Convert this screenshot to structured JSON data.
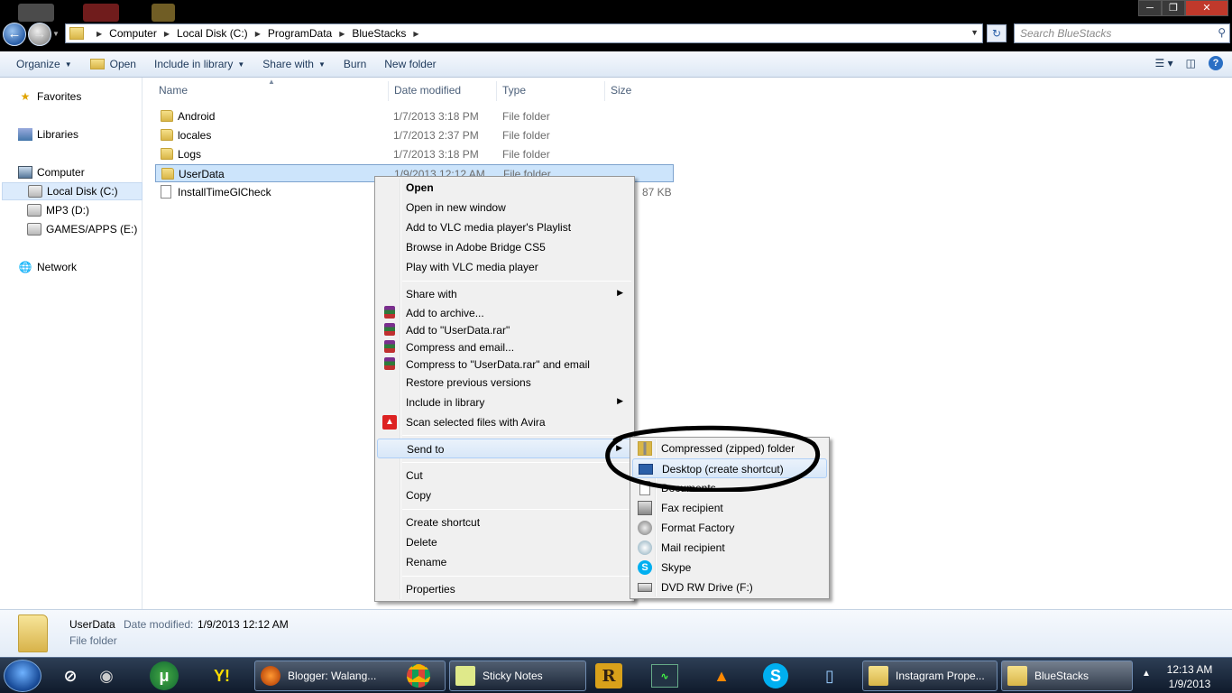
{
  "window": {
    "breadcrumb": [
      "Computer",
      "Local Disk (C:)",
      "ProgramData",
      "BlueStacks"
    ],
    "search_placeholder": "Search BlueStacks"
  },
  "toolbar": {
    "organize": "Organize",
    "open": "Open",
    "include_in_library": "Include in library",
    "share_with": "Share with",
    "burn": "Burn",
    "new_folder": "New folder"
  },
  "nav": {
    "favorites": "Favorites",
    "libraries": "Libraries",
    "computer": "Computer",
    "local_disk": "Local Disk (C:)",
    "mp3": "MP3 (D:)",
    "games": "GAMES/APPS (E:)",
    "network": "Network"
  },
  "columns": {
    "name": "Name",
    "date_modified": "Date modified",
    "type": "Type",
    "size": "Size"
  },
  "files": [
    {
      "name": "Android",
      "date": "1/7/2013 3:18 PM",
      "type": "File folder",
      "size": ""
    },
    {
      "name": "locales",
      "date": "1/7/2013 2:37 PM",
      "type": "File folder",
      "size": ""
    },
    {
      "name": "Logs",
      "date": "1/7/2013 3:18 PM",
      "type": "File folder",
      "size": ""
    },
    {
      "name": "UserData",
      "date": "1/9/2013 12:12 AM",
      "type": "File folder",
      "size": ""
    },
    {
      "name": "InstallTimeGlCheck",
      "date": "",
      "type": "",
      "size": "87 KB"
    }
  ],
  "context_menu": {
    "open": "Open",
    "open_new_window": "Open in new window",
    "add_vlc_playlist": "Add to VLC media player's Playlist",
    "browse_bridge": "Browse in Adobe Bridge CS5",
    "play_vlc": "Play with VLC media player",
    "share_with": "Share with",
    "add_archive": "Add to archive...",
    "add_rar": "Add to \"UserData.rar\"",
    "compress_email": "Compress and email...",
    "compress_rar_email": "Compress to \"UserData.rar\" and email",
    "restore": "Restore previous versions",
    "include_library": "Include in library",
    "avira": "Scan selected files with Avira",
    "send_to": "Send to",
    "cut": "Cut",
    "copy": "Copy",
    "create_shortcut": "Create shortcut",
    "delete": "Delete",
    "rename": "Rename",
    "properties": "Properties"
  },
  "send_to_menu": {
    "compressed": "Compressed (zipped) folder",
    "desktop": "Desktop (create shortcut)",
    "documents": "Documents",
    "fax": "Fax recipient",
    "format_factory": "Format Factory",
    "mail": "Mail recipient",
    "skype": "Skype",
    "dvd": "DVD RW Drive (F:)"
  },
  "details": {
    "name": "UserData",
    "modified_label": "Date modified:",
    "modified_value": "1/9/2013 12:12 AM",
    "type": "File folder"
  },
  "taskbar": {
    "firefox_task": "Blogger: Walang...",
    "sticky_task": "Sticky Notes",
    "instagram_task": "Instagram Prope...",
    "bluestacks_task": "BlueStacks",
    "time": "12:13 AM",
    "date": "1/9/2013"
  },
  "colors": {
    "selection": "#cce4fb",
    "menu_bg": "#f0f0f0",
    "annotation": "#000000"
  }
}
